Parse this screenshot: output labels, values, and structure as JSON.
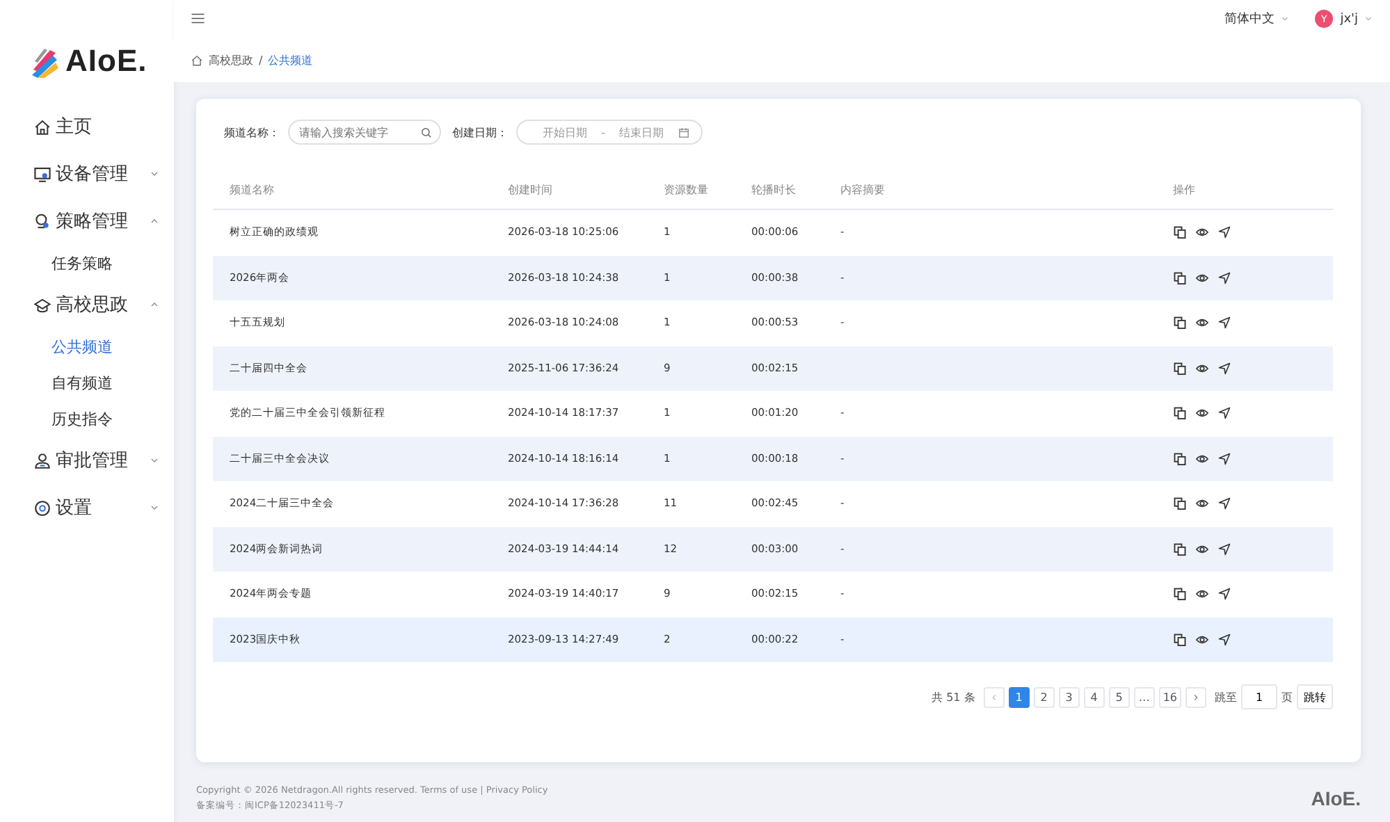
{
  "logo": {
    "text": "AIoE."
  },
  "sidebar": {
    "items": [
      {
        "label": "主页",
        "selected": false
      },
      {
        "label": "设备管理",
        "expanded": false,
        "selected": false
      },
      {
        "label": "策略管理",
        "expanded": true,
        "selected": false,
        "children": [
          {
            "label": "任务策略",
            "selected": false
          }
        ]
      },
      {
        "label": "高校思政",
        "expanded": true,
        "selected": false,
        "children": [
          {
            "label": "公共频道",
            "selected": true
          },
          {
            "label": "自有频道",
            "selected": false
          },
          {
            "label": "历史指令",
            "selected": false
          }
        ]
      },
      {
        "label": "审批管理",
        "expanded": false,
        "selected": false
      },
      {
        "label": "设置",
        "expanded": false,
        "selected": false
      }
    ]
  },
  "header": {
    "language": "简体中文",
    "avatar_letter": "Y",
    "user": "jx'j"
  },
  "breadcrumb": [
    "高校思政",
    "/",
    "公共频道"
  ],
  "filters": {
    "name_label": "频道名称：",
    "name_placeholder": "请输入搜索关键字",
    "date_label": "创建日期：",
    "start_placeholder": "开始日期",
    "separator": "-",
    "end_placeholder": "结束日期"
  },
  "table": {
    "columns": [
      "频道名称",
      "创建时间",
      "资源数量",
      "轮播时长",
      "内容摘要",
      "操作"
    ],
    "rows": [
      {
        "name": "树立正确的政绩观",
        "created": "2026-03-18 10:25:06",
        "resources": "1",
        "duration": "00:00:06",
        "summary": "-"
      },
      {
        "name": "2026年两会",
        "created": "2026-03-18 10:24:38",
        "resources": "1",
        "duration": "00:00:38",
        "summary": "-"
      },
      {
        "name": "十五五规划",
        "created": "2026-03-18 10:24:08",
        "resources": "1",
        "duration": "00:00:53",
        "summary": "-"
      },
      {
        "name": "二十届四中全会",
        "created": "2025-11-06 17:36:24",
        "resources": "9",
        "duration": "00:02:15"
      },
      {
        "name": "党的二十届三中全会引领新征程",
        "created": "2024-10-14 18:17:37",
        "resources": "1",
        "duration": "00:01:20",
        "summary": "-"
      },
      {
        "name": "二十届三中全会决议",
        "created": "2024-10-14 18:16:14",
        "resources": "1",
        "duration": "00:00:18",
        "summary": "-"
      },
      {
        "name": "2024二十届三中全会",
        "created": "2024-10-14 17:36:28",
        "resources": "11",
        "duration": "00:02:45",
        "summary": "-"
      },
      {
        "name": "2024两会新词热词",
        "created": "2024-03-19 14:44:14",
        "resources": "12",
        "duration": "00:03:00",
        "summary": "-"
      },
      {
        "name": "2024年两会专题",
        "created": "2024-03-19 14:40:17",
        "resources": "9",
        "duration": "00:02:15",
        "summary": "-"
      },
      {
        "name": "2023国庆中秋",
        "created": "2023-09-13 14:27:49",
        "resources": "2",
        "duration": "00:00:22",
        "summary": "-"
      }
    ]
  },
  "pagination": {
    "total": "共 51 条",
    "pages": [
      {
        "label": "1",
        "selected": true
      },
      {
        "label": "2",
        "selected": false
      },
      {
        "label": "3",
        "selected": false
      },
      {
        "label": "4",
        "selected": false
      },
      {
        "label": "5",
        "selected": false
      },
      {
        "label": "…",
        "selected": false
      },
      {
        "label": "16",
        "selected": false
      }
    ],
    "jump_label": "跳至",
    "jump_value": "1",
    "page_unit": "页",
    "jump_button": "跳转"
  },
  "footer": {
    "copyright": "Copyright © 2026 Netdragon.All rights reserved. Terms of use | Privacy Policy",
    "icp": "备案编号：闽ICP备12023411号-7",
    "logo": "AIoE."
  }
}
